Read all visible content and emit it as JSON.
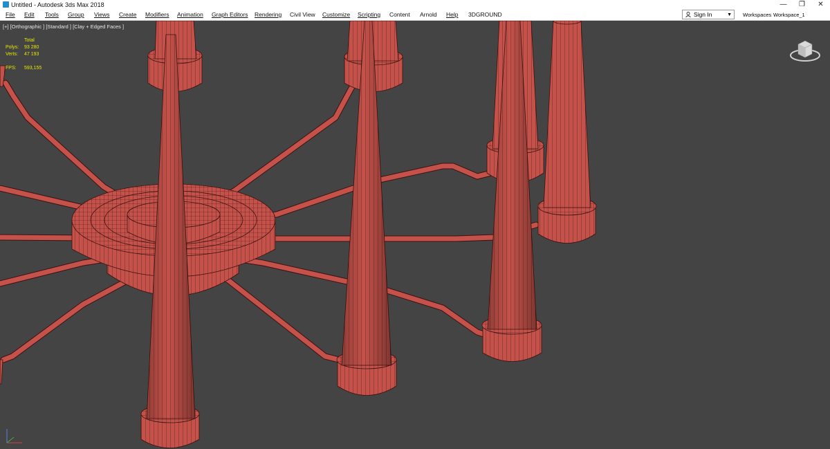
{
  "window": {
    "title": "Untitled - Autodesk 3ds Max 2018",
    "minimize": "—",
    "maximize": "❐",
    "close": "✕"
  },
  "menubar": {
    "items": [
      "File",
      "Edit",
      "Tools",
      "Group",
      "Views",
      "Create",
      "Modifiers",
      "Animation",
      "Graph Editors",
      "Rendering",
      "Civil View",
      "Customize",
      "Scripting",
      "Content",
      "Arnold",
      "Help",
      "3DGROUND"
    ],
    "sign_in": "Sign In",
    "workspaces_label": "Workspaces:",
    "workspace_value": "Workspace_1"
  },
  "viewport": {
    "label": "[+] [Orthographic ] [Standard ] [Clay + Edged Faces ]",
    "stats": {
      "header": "Total",
      "polys_label": "Polys:",
      "polys_value": "93 280",
      "verts_label": "Verts:",
      "verts_value": "47 193",
      "fps_label": "FPS:",
      "fps_value": "593,155"
    }
  },
  "colors": {
    "model_fill": "#c4524a",
    "model_wire": "#3a1210",
    "viewport_bg": "#444444",
    "stats_text": "#e8e800"
  }
}
